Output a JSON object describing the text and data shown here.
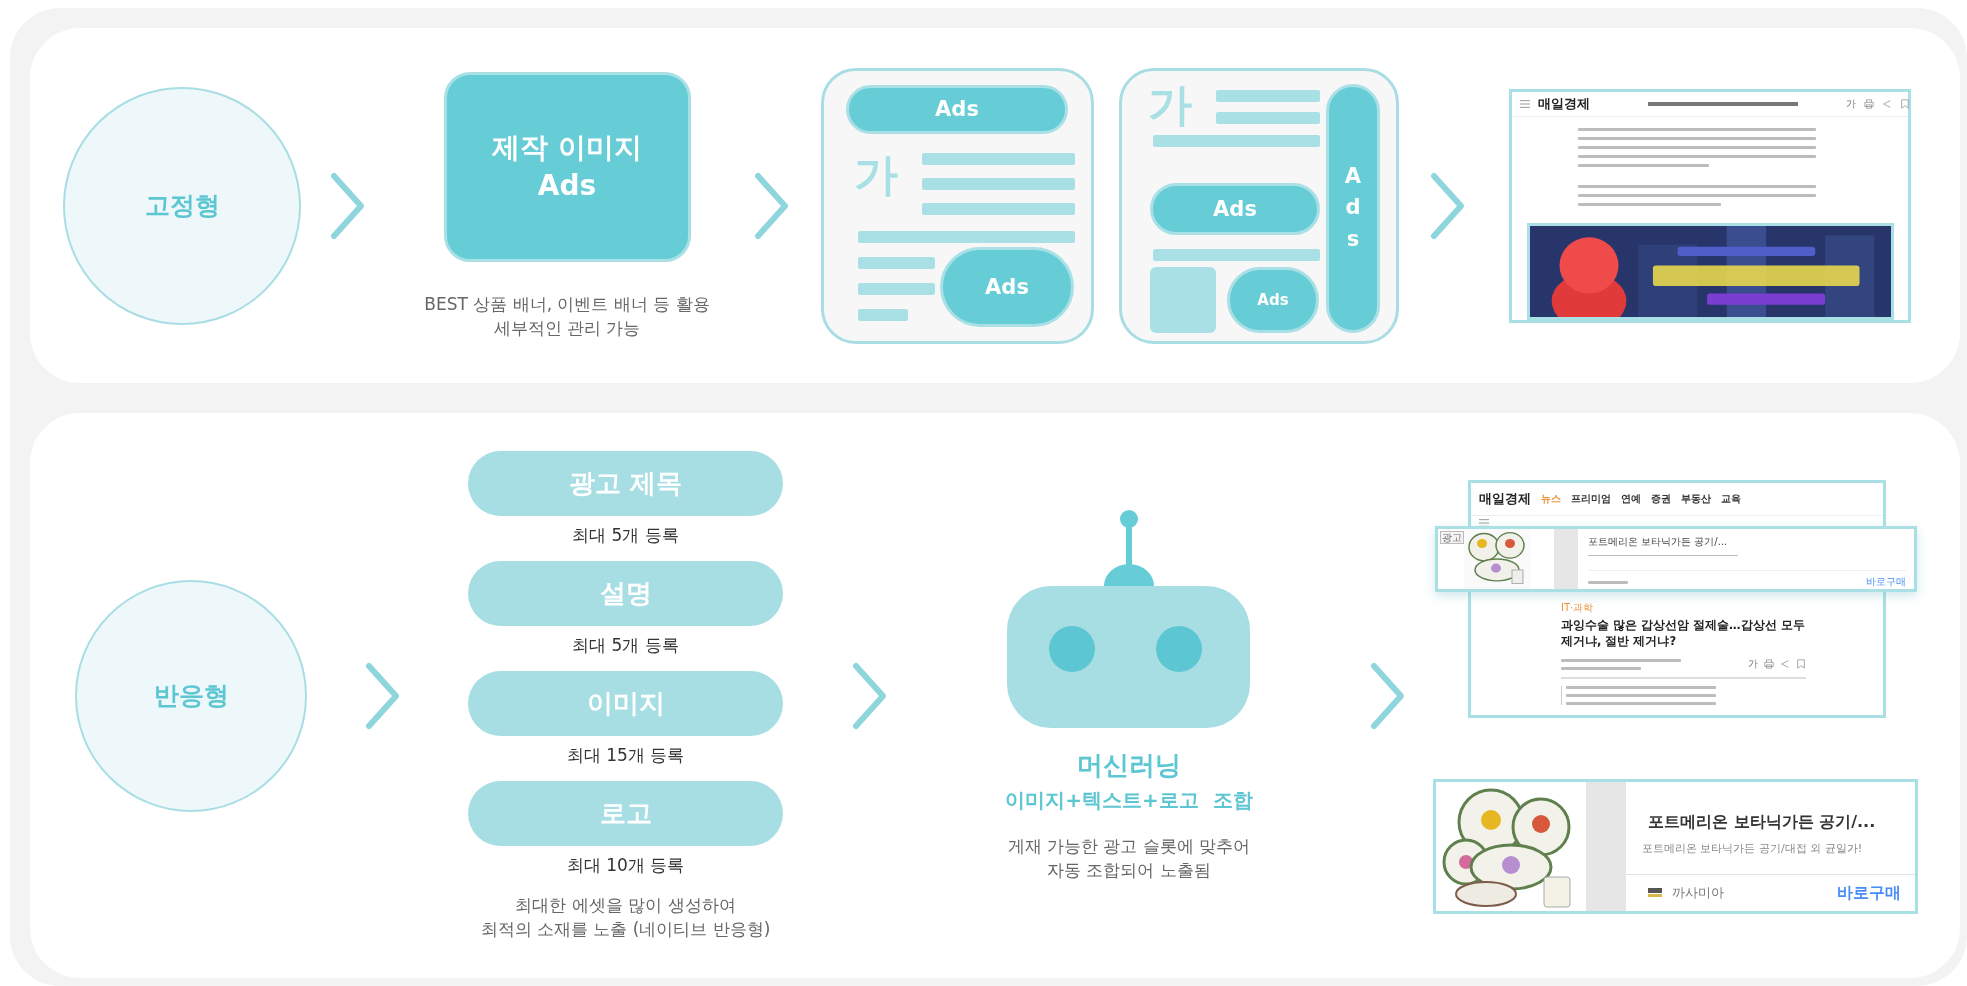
{
  "fixed": {
    "label": "고정형",
    "asset": {
      "title": "제작 이미지",
      "tag": "Ads",
      "caption": [
        "BEST 상품 배너, 이벤트 배너 등 활용",
        "세부적인 관리 가능"
      ]
    },
    "layouts": [
      {
        "kind": "top-banner",
        "glyph": "가",
        "ads": [
          "Ads",
          "Ads"
        ]
      },
      {
        "kind": "side-banner",
        "glyph": "가",
        "ads": [
          "Ads",
          "Ads",
          "Ads"
        ]
      }
    ],
    "example": {
      "logo": "매일경제",
      "font_icon": "가"
    }
  },
  "responsive": {
    "label": "반응형",
    "assets": [
      {
        "name": "광고 제목",
        "limit": "최대 5개 등록"
      },
      {
        "name": "설명",
        "limit": "최대 5개 등록"
      },
      {
        "name": "이미지",
        "limit": "최대 15개 등록"
      },
      {
        "name": "로고",
        "limit": "최대 10개 등록"
      }
    ],
    "assets_note": [
      "최대한 에셋을 많이 생성하여",
      "최적의 소재를 노출 (네이티브 반응형)"
    ],
    "engine": {
      "title": "머신러닝",
      "subtitle": "이미지+텍스트+로고  조합",
      "caption": [
        "게재 가능한 광고 슬롯에 맞추어",
        "자동 조합되어 노출됨"
      ]
    },
    "example_page": {
      "logo": "매일경제",
      "nav": [
        {
          "label": "뉴스",
          "selected": true
        },
        {
          "label": "프리미엄",
          "selected": false
        },
        {
          "label": "연예",
          "selected": false
        },
        {
          "label": "증권",
          "selected": false
        },
        {
          "label": "부동산",
          "selected": false
        },
        {
          "label": "교육",
          "selected": false
        }
      ],
      "ad": {
        "badge": "광고",
        "title": "포트메리온 보타닉가든 공기/...",
        "cta": "바로구매"
      },
      "article": {
        "section": "IT·과학",
        "headline": "과잉수술 많은 갑상선암 절제술…갑상선 모두 제거냐, 절반 제거냐?",
        "font_icon": "가"
      }
    },
    "example_ad": {
      "title": "포트메리온 보타닉가든 공기/...",
      "description": "포트메리온 보타닉가든 공기/대접 외 균일가!",
      "advertiser": "까사미아",
      "cta": "바로구매"
    }
  }
}
